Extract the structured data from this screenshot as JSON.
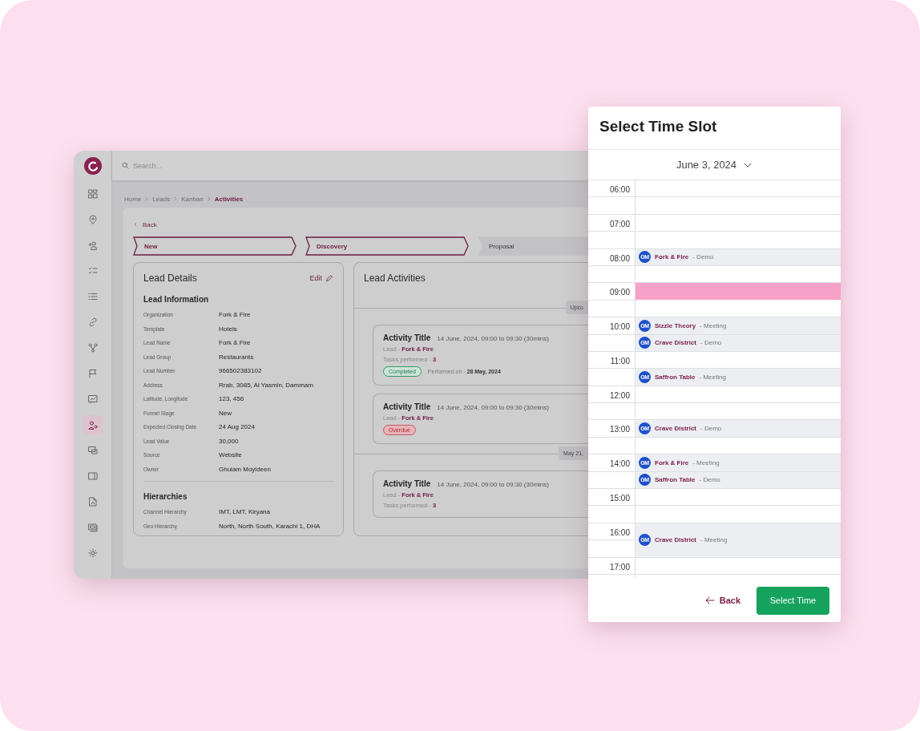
{
  "app": {
    "search": {
      "placeholder": "Search..."
    },
    "sidebar": {
      "items": [
        {
          "selected": false
        },
        {
          "selected": false
        },
        {
          "selected": false
        },
        {
          "selected": false
        },
        {
          "selected": false
        },
        {
          "selected": false
        },
        {
          "selected": false
        },
        {
          "selected": false
        },
        {
          "selected": false
        },
        {
          "selected": true
        },
        {
          "selected": false
        },
        {
          "selected": false
        },
        {
          "selected": false
        },
        {
          "selected": false
        },
        {
          "selected": false
        }
      ]
    },
    "breadcrumb": [
      {
        "label": "Home",
        "current": false
      },
      {
        "label": "Leads",
        "current": false
      },
      {
        "label": "Kanban",
        "current": false
      },
      {
        "label": "Activities",
        "current": true
      }
    ],
    "back": "Back",
    "stages": [
      {
        "label": "New",
        "done": true
      },
      {
        "label": "Discovery",
        "done": true
      },
      {
        "label": "Proposal",
        "done": false
      }
    ],
    "lead_details": {
      "title": "Lead Details",
      "edit": "Edit",
      "sections": [
        {
          "title": "Lead Information",
          "fields": [
            {
              "label": "Organization",
              "value": "Fork & Fire"
            },
            {
              "label": "Template",
              "value": "Hotels"
            },
            {
              "label": "Lead Name",
              "value": "Fork & Fire"
            },
            {
              "label": "Lead Group",
              "value": "Restaurants"
            },
            {
              "label": "Lead Number",
              "value": "966502383102"
            },
            {
              "label": "Address",
              "value": "Rrab, 3085, Al Yasmin, Dammam"
            },
            {
              "label": "Latitude, Longitude",
              "value": "123, 456"
            },
            {
              "label": "Funnel Stage",
              "value": "New"
            },
            {
              "label": "Expected Closing Date",
              "value": "24 Aug 2024"
            },
            {
              "label": "Lead Value",
              "value": "30,000"
            },
            {
              "label": "Source",
              "value": "Website"
            },
            {
              "label": "Owner",
              "value": "Ghulam Moyideen"
            }
          ]
        },
        {
          "title": "Hierarchies",
          "fields": [
            {
              "label": "Channel Hierarchy",
              "value": "IMT, LMT, Kiryana"
            },
            {
              "label": "Geo Hierarchy",
              "value": "North, North South, Karachi 1, DHA"
            }
          ]
        }
      ]
    },
    "lead_activities": {
      "title": "Lead Activities",
      "groups": [
        {
          "label": "Upco",
          "activities": [
            {
              "title": "Activity Title",
              "time": "14 June, 2024, 09:00 to 09:30 (30mins)",
              "lead_label": "Lead - ",
              "lead": "Fork & Fire",
              "tasks_label": "Tasks performed - ",
              "tasks": "3",
              "status": "Completed",
              "kind": "completed",
              "performed_label": "Performed on - ",
              "performed": "28 May, 2024"
            },
            {
              "title": "Activity Title",
              "time": "14 June, 2024, 09:00 to 09:30 (30mins)",
              "lead_label": "Lead - ",
              "lead": "Fork & Fire",
              "status": "Overdue",
              "kind": "overdue"
            }
          ]
        },
        {
          "label": "May 21,",
          "activities": [
            {
              "title": "Activity Title",
              "time": "14 June, 2024, 09:00 to 09:30 (30mins)",
              "lead_label": "Lead - ",
              "lead": "Fork & Fire",
              "tasks_label": "Tasks performed - ",
              "tasks": "3"
            }
          ]
        }
      ]
    }
  },
  "modal": {
    "title": "Select Time Slot",
    "date": "June 3, 2024",
    "hours": [
      {
        "time": "06:00",
        "selected": false
      },
      {
        "time": "07:00",
        "selected": false
      },
      {
        "time": "08:00",
        "selected": false,
        "events": [
          {
            "initials": "GM",
            "name": "Fork & Fire",
            "detail": "- Demo",
            "kind": "half"
          }
        ]
      },
      {
        "time": "09:00",
        "selected": true
      },
      {
        "time": "10:00",
        "selected": false,
        "events": [
          {
            "initials": "GM",
            "name": "Sizzle Theory",
            "detail": "- Meeting",
            "kind": "half"
          },
          {
            "initials": "GM",
            "name": "Crave District",
            "detail": "- Demo",
            "kind": "half"
          }
        ]
      },
      {
        "time": "11:00",
        "selected": false,
        "events": [
          {
            "initials": "GM",
            "name": "Saffron Table",
            "detail": "- Meeting",
            "kind": "late"
          }
        ]
      },
      {
        "time": "12:00",
        "selected": false
      },
      {
        "time": "13:00",
        "selected": false,
        "events": [
          {
            "initials": "GM",
            "name": "Crave District",
            "detail": "- Demo",
            "kind": "half"
          }
        ]
      },
      {
        "time": "14:00",
        "selected": false,
        "events": [
          {
            "initials": "GM",
            "name": "Fork & Fire",
            "detail": "- Meeting",
            "kind": "half"
          },
          {
            "initials": "GM",
            "name": "Saffron Table",
            "detail": "- Demo",
            "kind": "half"
          }
        ]
      },
      {
        "time": "15:00",
        "selected": false
      },
      {
        "time": "16:00",
        "selected": false,
        "events": [
          {
            "initials": "GM",
            "name": "Crave District",
            "detail": "- Meeting",
            "kind": "hour"
          }
        ]
      },
      {
        "time": "17:00",
        "selected": false
      }
    ],
    "back": "Back",
    "confirm": "Select Time"
  }
}
